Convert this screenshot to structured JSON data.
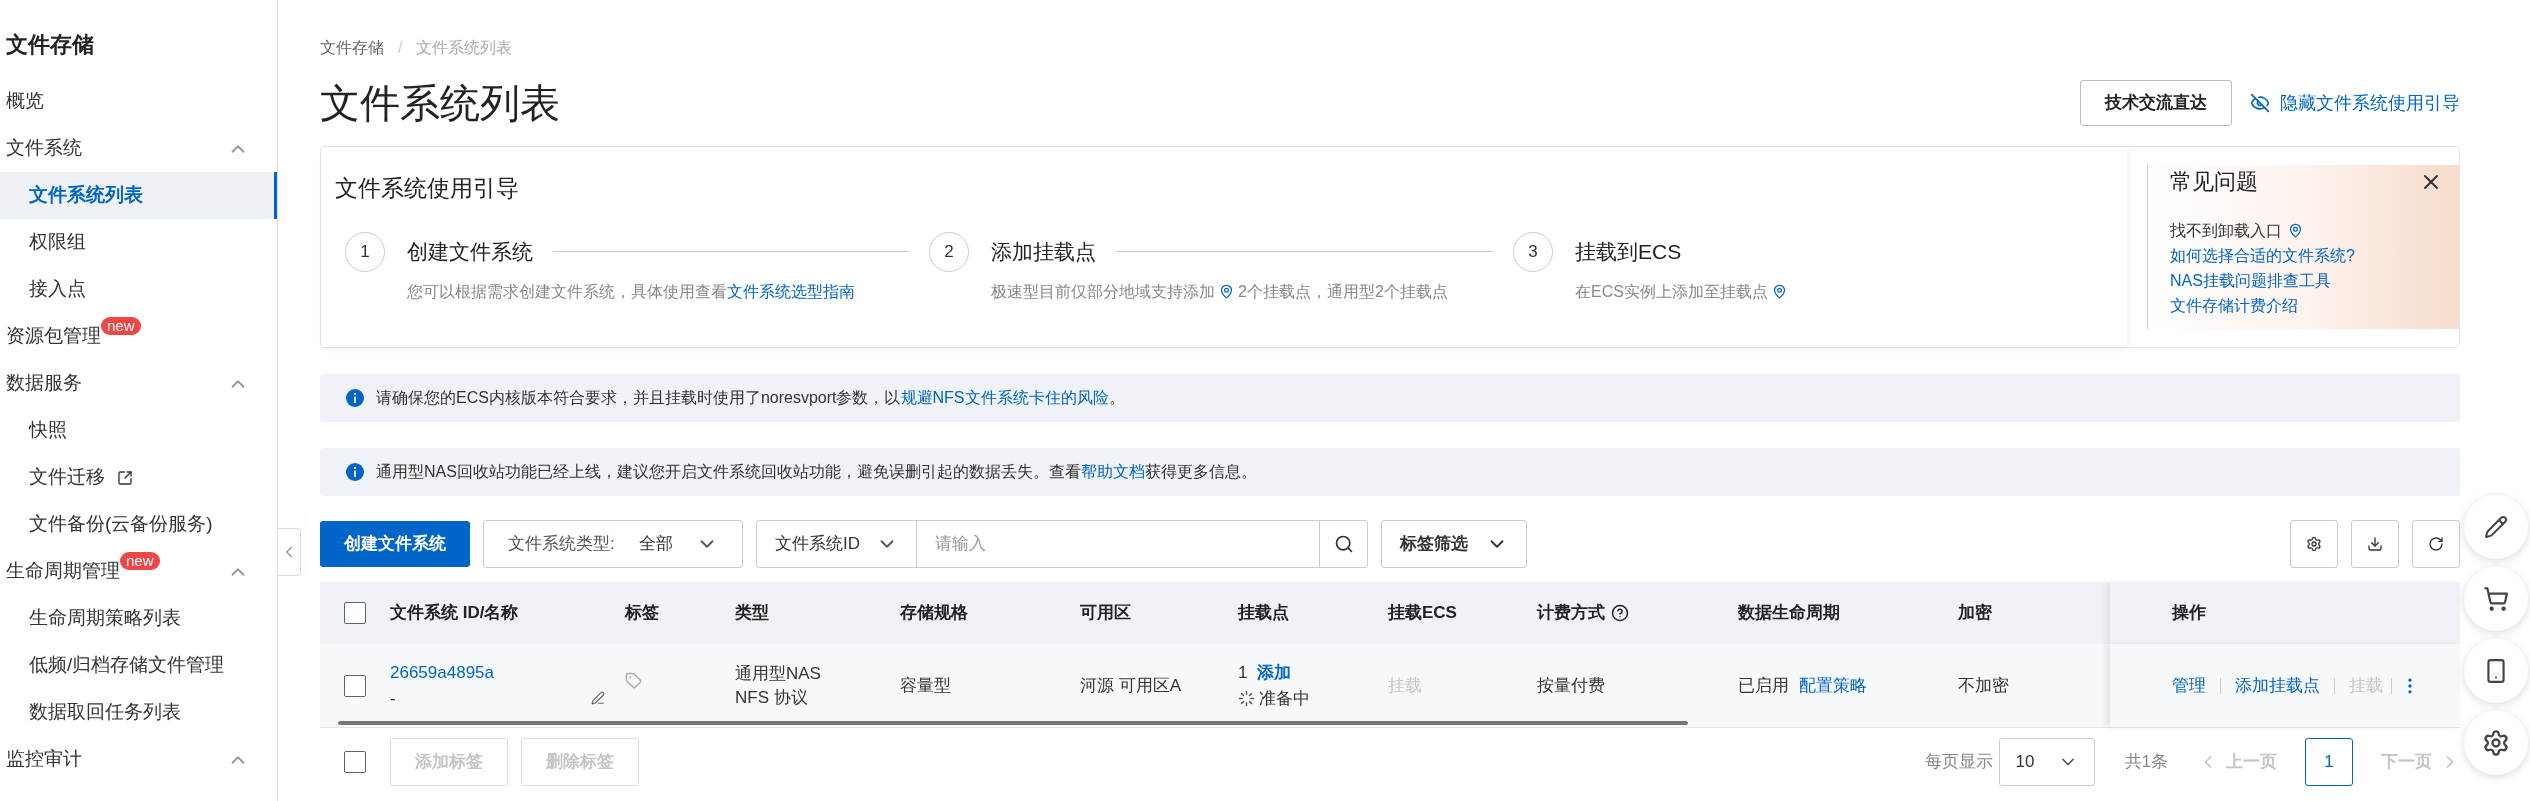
{
  "sidebar": {
    "title": "文件存储",
    "items": [
      {
        "label": "概览",
        "selected": false
      },
      {
        "label": "文件系统",
        "selected": false,
        "expanded": true,
        "children": [
          {
            "label": "文件系统列表",
            "selected": true
          },
          {
            "label": "权限组",
            "selected": false
          },
          {
            "label": "接入点",
            "selected": false
          }
        ]
      },
      {
        "label": "资源包管理",
        "selected": false,
        "badge": "new"
      },
      {
        "label": "数据服务",
        "selected": false,
        "expanded": true,
        "children": [
          {
            "label": "快照",
            "selected": false
          },
          {
            "label": "文件迁移",
            "selected": false,
            "external": true
          },
          {
            "label": "文件备份(云备份服务)",
            "selected": false
          }
        ]
      },
      {
        "label": "生命周期管理",
        "selected": false,
        "badge": "new",
        "expanded": true,
        "children": [
          {
            "label": "生命周期策略列表",
            "selected": false
          },
          {
            "label": "低频/归档存储文件管理",
            "selected": false
          },
          {
            "label": "数据取回任务列表",
            "selected": false
          }
        ]
      },
      {
        "label": "监控审计",
        "selected": false,
        "expanded": true
      }
    ]
  },
  "breadcrumb": [
    "文件存储",
    "文件系统列表"
  ],
  "breadcrumb_separator": "/",
  "page_title": "文件系统列表",
  "header_actions": {
    "contact": "技术交流直达",
    "hide_guide": "隐藏文件系统使用引导"
  },
  "guide": {
    "title": "文件系统使用引导",
    "steps": [
      {
        "number": "1",
        "title": "创建文件系统",
        "segments": [
          {
            "kind": "text",
            "text": "您可以根据需求创建文件系统，具体使用查看"
          },
          {
            "kind": "link",
            "text": "文件系统选型指南"
          }
        ]
      },
      {
        "number": "2",
        "title": "添加挂载点",
        "segments": [
          {
            "kind": "text",
            "text": "极速型目前仅部分地域支持添加"
          },
          {
            "kind": "pin"
          },
          {
            "kind": "text",
            "text": "2个挂载点，通用型2个挂载点"
          }
        ]
      },
      {
        "number": "3",
        "title": "挂载到ECS",
        "segments": [
          {
            "kind": "text",
            "text": "在ECS实例上添加至挂载点"
          },
          {
            "kind": "pin"
          }
        ]
      }
    ],
    "faq": {
      "title": "常见问题",
      "items": [
        {
          "text": "找不到卸载入口",
          "kind": "pin"
        },
        {
          "text": "如何选择合适的文件系统?",
          "kind": "link"
        },
        {
          "text": "NAS挂载问题排查工具",
          "kind": "link"
        },
        {
          "text": "文件存储计费介绍",
          "kind": "link"
        }
      ]
    }
  },
  "alerts": [
    {
      "segments": [
        {
          "kind": "text",
          "text": "请确保您的ECS内核版本符合要求，并且挂载时使用了noresvport参数，以"
        },
        {
          "kind": "link",
          "text": "规避NFS文件系统卡住的风险"
        },
        {
          "kind": "text",
          "text": "。"
        }
      ]
    },
    {
      "segments": [
        {
          "kind": "text",
          "text": "通用型NAS回收站功能已经上线，建议您开启文件系统回收站功能，避免误删引起的数据丢失。查看"
        },
        {
          "kind": "link",
          "text": "帮助文档"
        },
        {
          "kind": "text",
          "text": "获得更多信息。"
        }
      ]
    }
  ],
  "toolbar": {
    "create": "创建文件系统",
    "type_filter": {
      "label": "文件系统类型:",
      "value": "全部"
    },
    "search": {
      "field": "文件系统ID",
      "placeholder": "请输入"
    },
    "tag_filter": "标签筛选"
  },
  "table": {
    "select_all": false,
    "columns": [
      "文件系统 ID/名称",
      "标签",
      "类型",
      "存储规格",
      "可用区",
      "挂载点",
      "挂载ECS",
      "计费方式",
      "数据生命周期",
      "加密",
      "操作"
    ],
    "rows": [
      {
        "checked": false,
        "id": "26659a4895a",
        "name": "-",
        "type": [
          "通用型NAS",
          "NFS 协议"
        ],
        "spec": "容量型",
        "zone": "河源 可用区A",
        "mount_count": "1",
        "mount_add": "添加",
        "mount_status": "准备中",
        "mount_ecs": {
          "label": "挂载",
          "disabled": true
        },
        "billing": "按量付费",
        "lifecycle": "已启用",
        "lifecycle_link": "配置策略",
        "encryption": "不加密",
        "actions": [
          {
            "label": "管理",
            "disabled": false
          },
          {
            "label": "添加挂载点",
            "disabled": false
          },
          {
            "label": "挂载",
            "disabled": true
          }
        ]
      }
    ]
  },
  "footer": {
    "select_all": false,
    "buttons": [
      {
        "label": "添加标签",
        "disabled": true
      },
      {
        "label": "删除标签",
        "disabled": true
      }
    ],
    "pagination": {
      "per_page_label": "每页显示",
      "per_page": "10",
      "total": "共1条",
      "prev": {
        "label": "上一页",
        "disabled": true
      },
      "pages": [
        {
          "label": "1",
          "selected": true
        }
      ],
      "next": {
        "label": "下一页",
        "disabled": true
      }
    }
  }
}
